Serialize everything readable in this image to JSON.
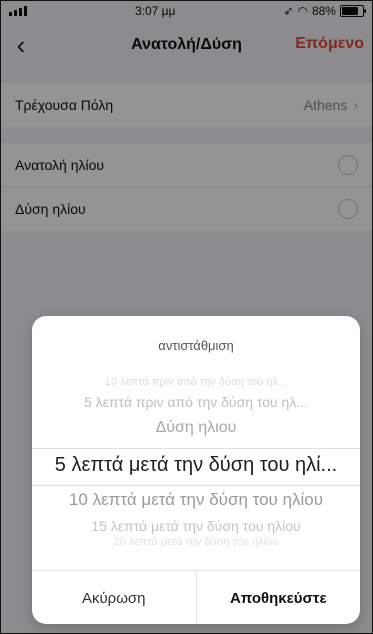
{
  "status": {
    "time": "3:07 μμ",
    "battery": "88%",
    "battery_level": 0.88
  },
  "nav": {
    "title": "Ανατολή/Δύση",
    "next": "Επόμενο"
  },
  "city": {
    "label": "Τρέχουσα Πόλη",
    "value": "Athens"
  },
  "options": {
    "sunrise": "Ανατολή ηλίου",
    "sunset": "Δύση ηλίου"
  },
  "sheet": {
    "title": "αντιστάθμιση",
    "picker": [
      "10 λεπτά πριν από την δύση του ηλ...",
      "5 λεπτά πριν από την δύση του ηλ...",
      "Δύση ηλιου",
      "5 λεπτά μετά την δύση του ηλί...",
      "10 λεπτά μετά την δύση του ηλίου",
      "15 λεπτά μετά την δύση του ηλίου",
      "20 λεπτά μετά την δύση του ηλίου"
    ],
    "cancel": "Ακύρωση",
    "save": "Αποθηκεύστε"
  }
}
